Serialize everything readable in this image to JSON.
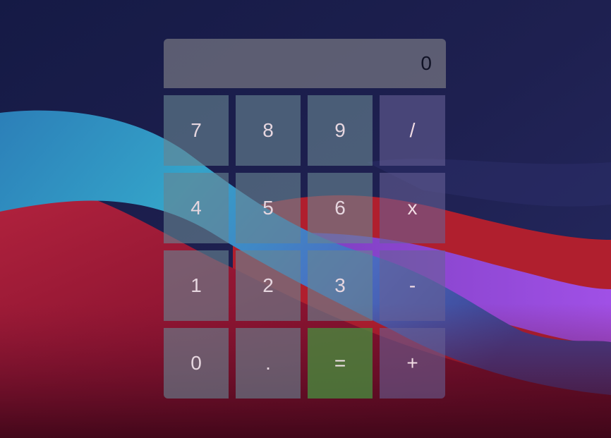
{
  "colors": {
    "digit_key": "#688492",
    "operator_key": "#686096",
    "equals_key": "#488c3e",
    "display": "#808087",
    "key_text": "#e6d6df"
  },
  "display": {
    "value": "0"
  },
  "keypad": {
    "rows": [
      [
        "7",
        "8",
        "9",
        "/"
      ],
      [
        "4",
        "5",
        "6",
        "x"
      ],
      [
        "1",
        "2",
        "3",
        "-"
      ],
      [
        "0",
        ".",
        "=",
        "+"
      ]
    ]
  }
}
